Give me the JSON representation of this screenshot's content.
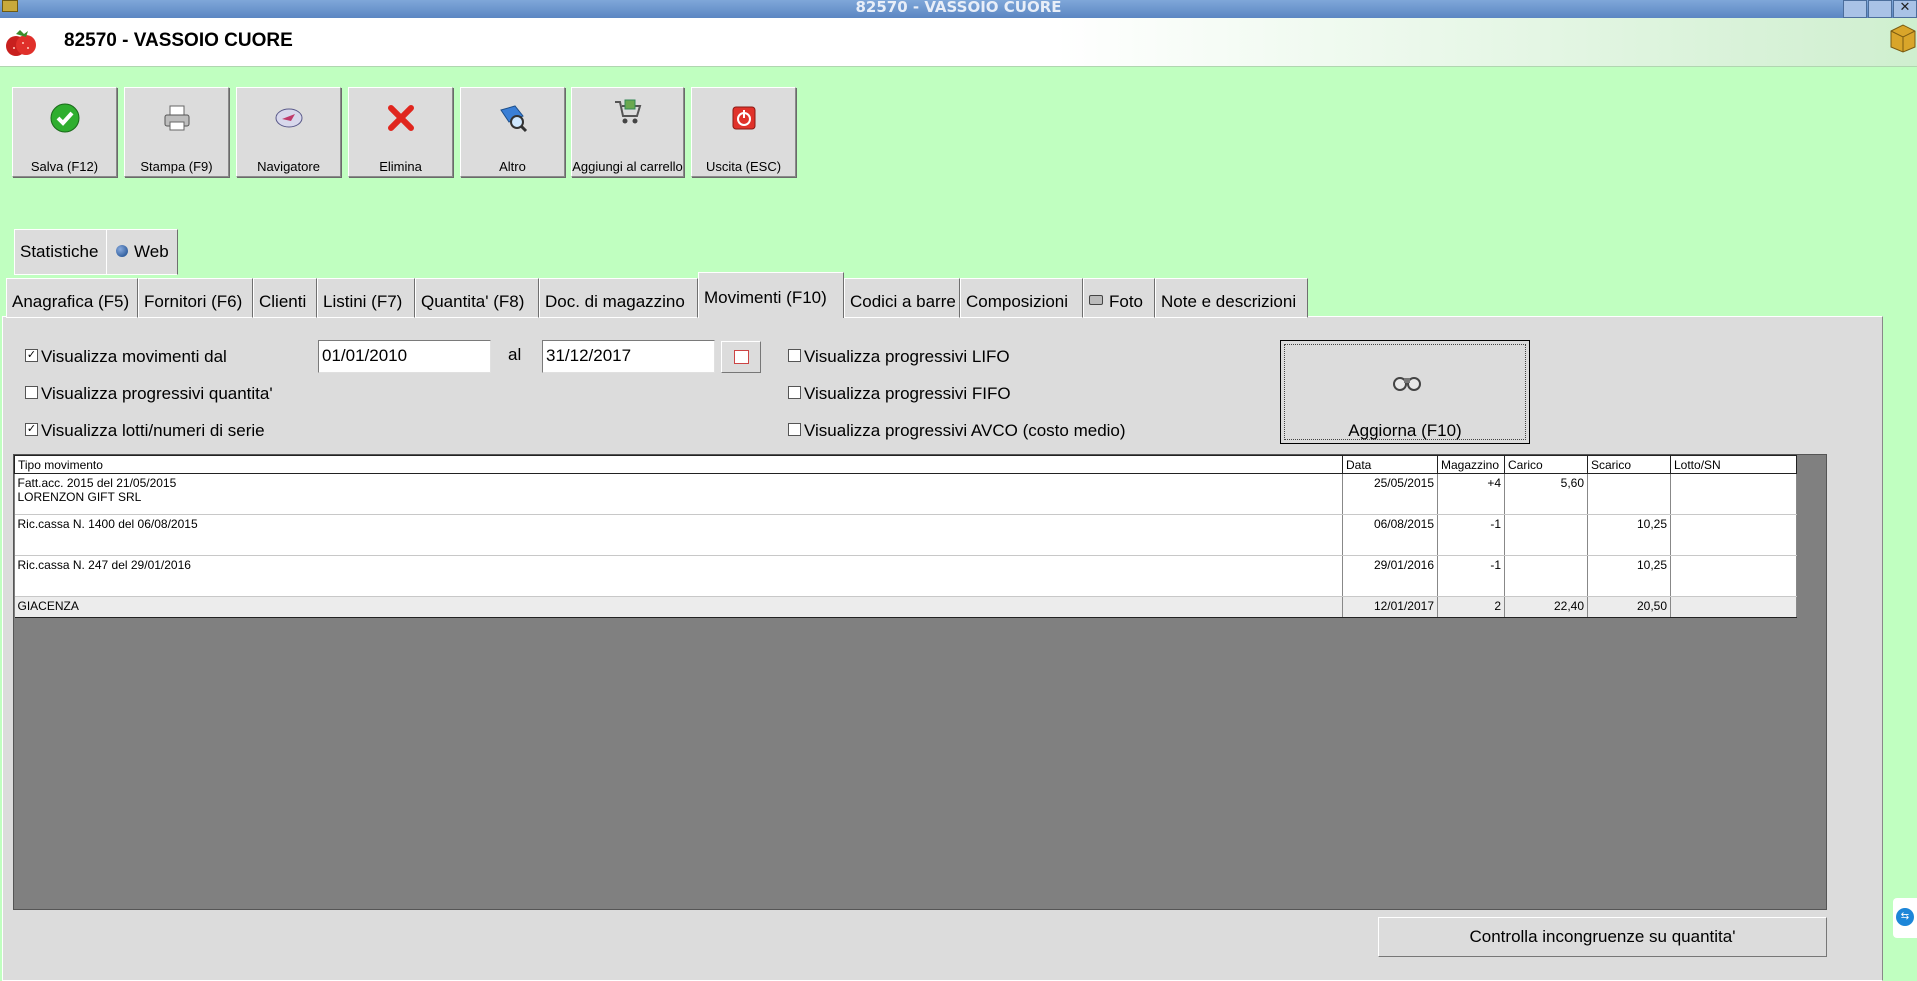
{
  "window": {
    "title": "82570 -  VASSOIO CUORE"
  },
  "header": {
    "title": "82570 -  VASSOIO CUORE"
  },
  "toolbar": {
    "buttons": [
      {
        "label": "Salva (F12)",
        "icon": "check-icon"
      },
      {
        "label": "Stampa (F9)",
        "icon": "printer-icon"
      },
      {
        "label": "Navigatore",
        "icon": "navigator-icon"
      },
      {
        "label": "Elimina",
        "icon": "delete-x-icon"
      },
      {
        "label": "Altro",
        "icon": "search-book-icon"
      },
      {
        "label": "Aggiungi al carrello",
        "icon": "cart-icon"
      },
      {
        "label": "Uscita (ESC)",
        "icon": "exit-power-icon"
      }
    ]
  },
  "tabs_top": [
    {
      "label": "Statistiche"
    },
    {
      "label": "Web",
      "icon": "globe-icon"
    }
  ],
  "tabs": [
    {
      "label": "Anagrafica (F5)"
    },
    {
      "label": "Fornitori (F6)"
    },
    {
      "label": "Clienti"
    },
    {
      "label": "Listini (F7)"
    },
    {
      "label": "Quantita' (F8)"
    },
    {
      "label": "Doc. di magazzino"
    },
    {
      "label": "Movimenti (F10)",
      "active": true
    },
    {
      "label": "Codici a barre"
    },
    {
      "label": "Composizioni"
    },
    {
      "label": "Foto",
      "icon": "camera-icon"
    },
    {
      "label": "Note e descrizioni"
    }
  ],
  "filters": {
    "show_from": {
      "label": "Visualizza movimenti dal",
      "checked": true
    },
    "date_from": "01/01/2010",
    "al_label": "al",
    "date_to": "31/12/2017",
    "prog_qty": {
      "label": "Visualizza progressivi quantita'",
      "checked": false
    },
    "lots": {
      "label": "Visualizza lotti/numeri di serie",
      "checked": true
    },
    "lifo": {
      "label": "Visualizza progressivi LIFO",
      "checked": false
    },
    "fifo": {
      "label": "Visualizza progressivi FIFO",
      "checked": false
    },
    "avco": {
      "label": "Visualizza progressivi AVCO (costo medio)",
      "checked": false
    },
    "refresh_label": "Aggiorna (F10)"
  },
  "grid": {
    "columns": [
      "Tipo movimento",
      "Data",
      "Magazzino",
      "Carico",
      "Scarico",
      "Lotto/SN"
    ],
    "rows": [
      {
        "tipo": "Fatt.acc. 2015 del 21/05/2015",
        "sub": "LORENZON GIFT SRL",
        "data": "25/05/2015",
        "magazzino": "+4",
        "carico": "5,60",
        "scarico": "",
        "lotto": ""
      },
      {
        "tipo": "Ric.cassa N. 1400 del 06/08/2015",
        "sub": "",
        "data": "06/08/2015",
        "magazzino": "-1",
        "carico": "",
        "scarico": "10,25",
        "lotto": ""
      },
      {
        "tipo": "Ric.cassa N. 247 del 29/01/2016",
        "sub": "",
        "data": "29/01/2016",
        "magazzino": "-1",
        "carico": "",
        "scarico": "10,25",
        "lotto": ""
      }
    ],
    "total": {
      "tipo": "GIACENZA",
      "data": "12/01/2017",
      "magazzino": "2",
      "carico": "22,40",
      "scarico": "20,50",
      "lotto": ""
    }
  },
  "check_button": "Controlla incongruenze su quantita'"
}
